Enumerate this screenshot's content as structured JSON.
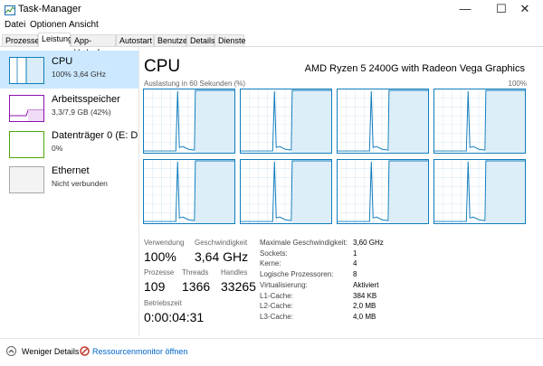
{
  "window": {
    "title": "Task-Manager",
    "minimize": "—",
    "maximize": "☐",
    "close": "✕"
  },
  "menu": [
    "Datei",
    "Optionen",
    "Ansicht"
  ],
  "tabs": [
    "Prozesse",
    "Leistung",
    "App-Verlauf",
    "Autostart",
    "Benutzer",
    "Details",
    "Dienste"
  ],
  "active_tab": "Leistung",
  "sidebar": [
    {
      "name": "CPU",
      "sub": "100% 3,64 GHz",
      "color": "#117dbb"
    },
    {
      "name": "Arbeitsspeicher",
      "sub": "3,3/7,9 GB (42%)",
      "color": "#8b12ae"
    },
    {
      "name": "Datenträger 0 (E: D",
      "sub": "0%",
      "color": "#4da60c"
    },
    {
      "name": "Ethernet",
      "sub": "Nicht verbunden",
      "color": "#a7a7a7"
    }
  ],
  "main": {
    "title": "CPU",
    "model": "AMD Ryzen 5 2400G with Radeon Vega Graphics",
    "graph_caption": "Auslastung in 60 Sekunden (%)",
    "graph_max": "100%",
    "graph_color": "#117dbb"
  },
  "stats": {
    "usage_label": "Verwendung",
    "usage_value": "100%",
    "speed_label": "Geschwindigkeit",
    "speed_value": "3,64 GHz",
    "processes_label": "Prozesse",
    "processes_value": "109",
    "threads_label": "Threads",
    "threads_value": "1366",
    "handles_label": "Handles",
    "handles_value": "33265",
    "uptime_label": "Betriebszeit",
    "uptime_value": "0:00:04:31"
  },
  "details": [
    {
      "label": "Maximale Geschwindigkeit:",
      "value": "3,60 GHz"
    },
    {
      "label": "Sockets:",
      "value": "1"
    },
    {
      "label": "Kerne:",
      "value": "4"
    },
    {
      "label": "Logische Prozessoren:",
      "value": "8"
    },
    {
      "label": "Virtualisierung:",
      "value": "Aktiviert"
    },
    {
      "label": "L1-Cache:",
      "value": "384 KB"
    },
    {
      "label": "L2-Cache:",
      "value": "2,0 MB"
    },
    {
      "label": "L3-Cache:",
      "value": "4,0 MB"
    }
  ],
  "footer": {
    "less_details": "Weniger Details",
    "resource_monitor": "Ressourcenmonitor öffnen"
  }
}
